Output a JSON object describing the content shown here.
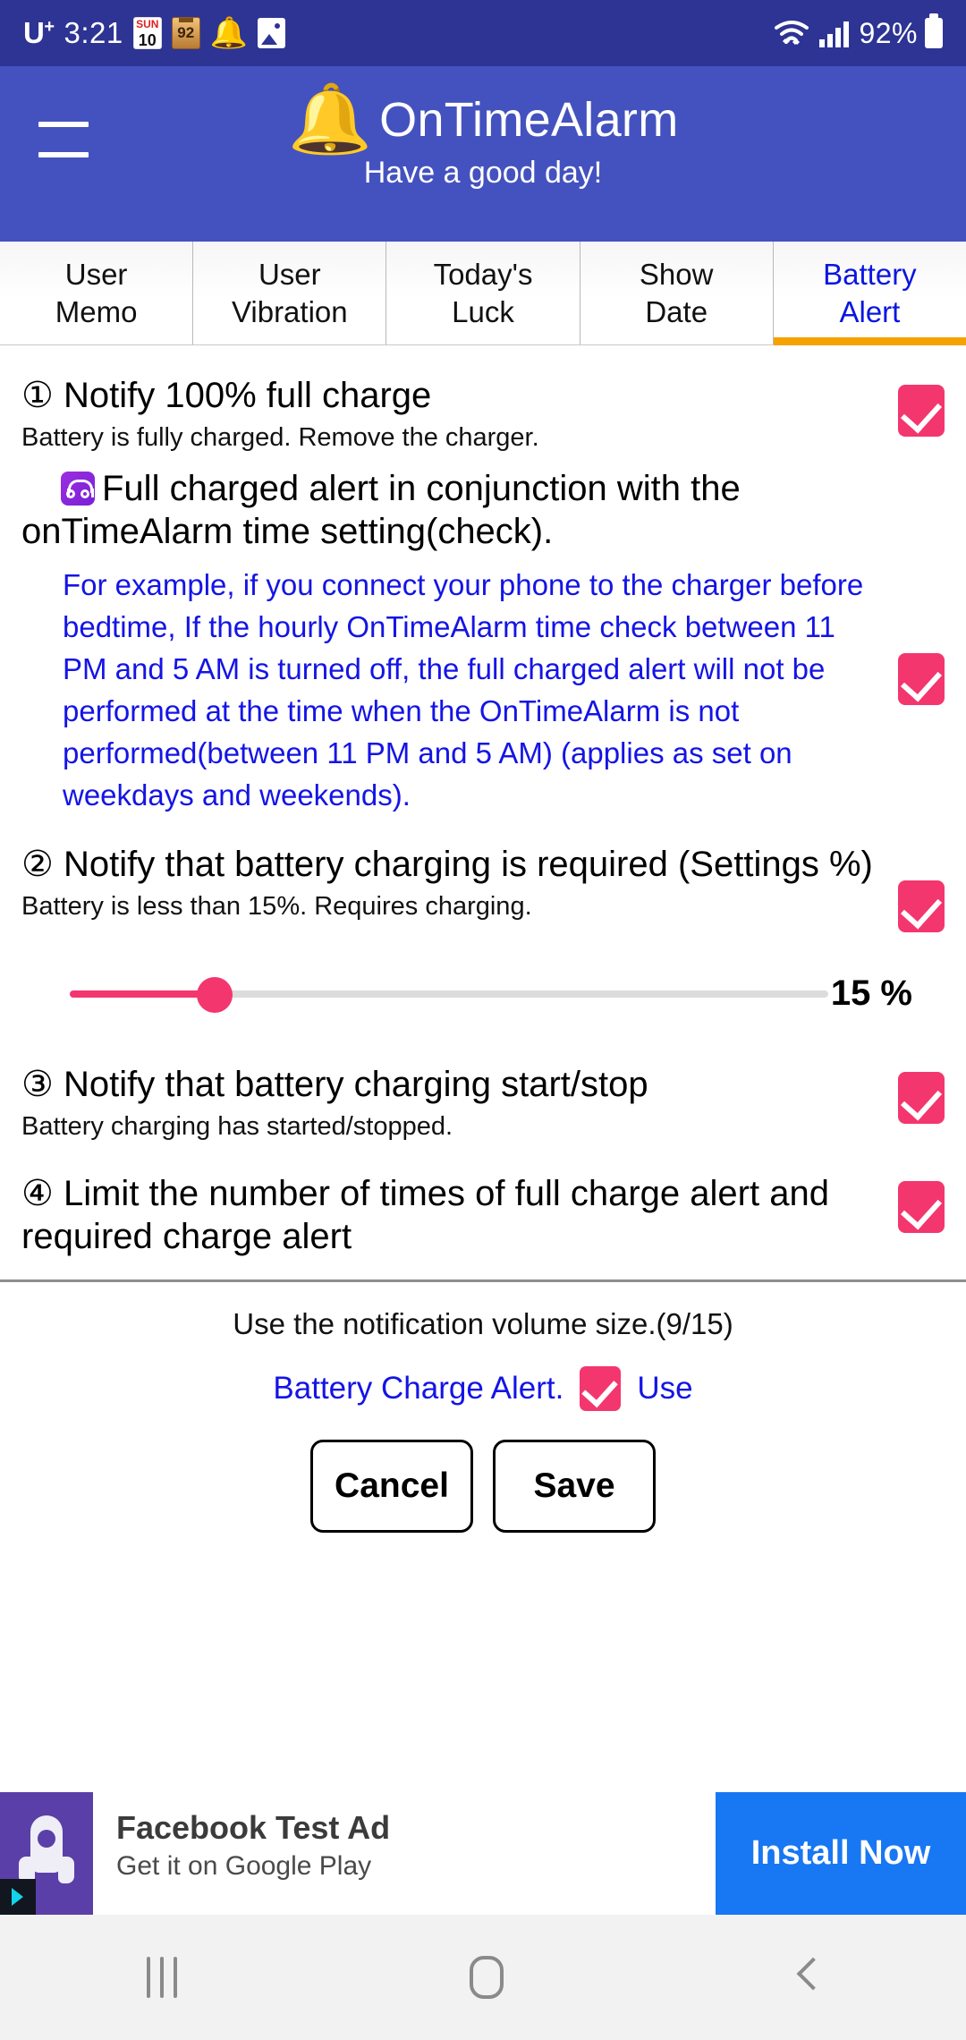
{
  "status_bar": {
    "carrier": "U",
    "carrier_sup": "+",
    "time": "3:21",
    "calendar_top": "SUN",
    "calendar_day": "10",
    "meter_value": "92",
    "battery_percent": "92%",
    "icons": [
      "calendar-icon",
      "meter-icon",
      "bell-icon",
      "image-icon",
      "wifi-icon",
      "signal-icon",
      "battery-icon"
    ]
  },
  "app_bar": {
    "menu_icon": "hamburger-menu-icon",
    "logo_icon": "bell-icon",
    "title": "OnTimeAlarm",
    "subtitle": "Have a good day!"
  },
  "tabs": [
    {
      "label_line1": "User",
      "label_line2": "Memo",
      "active": false
    },
    {
      "label_line1": "User",
      "label_line2": "Vibration",
      "active": false
    },
    {
      "label_line1": "Today's",
      "label_line2": "Luck",
      "active": false
    },
    {
      "label_line1": "Show",
      "label_line2": "Date",
      "active": false
    },
    {
      "label_line1": "Battery",
      "label_line2": "Alert",
      "active": true
    }
  ],
  "sections": {
    "item1": {
      "title": "① Notify 100% full charge",
      "subtitle": "Battery is fully charged. Remove the charger.",
      "checked": true
    },
    "item1b": {
      "icon": "headphone-icon",
      "title": "Full charged alert in conjunction with the onTimeAlarm time setting(check).",
      "example": "For example, if you connect your phone to the charger before bedtime, If the hourly OnTimeAlarm time check between 11 PM and 5 AM is turned off, the full charged alert will not be performed at the time when the OnTimeAlarm is not performed(between 11 PM and 5 AM) (applies as set on weekdays and weekends).",
      "checked": true
    },
    "item2": {
      "title": "② Notify that battery charging is required (Settings %)",
      "subtitle": "Battery is less than 15%. Requires charging.",
      "checked": true,
      "slider_value": "15 %",
      "slider_percent": 15
    },
    "item3": {
      "title": "③ Notify that battery charging start/stop",
      "subtitle": "Battery charging has started/stopped.",
      "checked": true
    },
    "item4": {
      "title": "④ Limit the number of times of full charge alert and required charge alert",
      "checked": true
    }
  },
  "footer": {
    "volume_note": "Use the notification volume size.(9/15)",
    "alert_label": "Battery Charge Alert.",
    "use_label": "Use",
    "use_checked": true,
    "cancel_label": "Cancel",
    "save_label": "Save"
  },
  "ad": {
    "icon": "rocket-app-icon",
    "title": "Facebook Test Ad",
    "subtitle": "Get it on Google Play",
    "cta": "Install Now"
  },
  "nav_bar": {
    "recent_icon": "recent-apps-icon",
    "home_icon": "home-icon",
    "back_icon": "back-icon"
  },
  "colors": {
    "status_bar": "#2d3494",
    "app_bar": "#4452bf",
    "accent_pink": "#f4366e",
    "accent_orange": "#f6a200",
    "link_blue": "#0b16e0",
    "ad_blue": "#1877f2"
  }
}
